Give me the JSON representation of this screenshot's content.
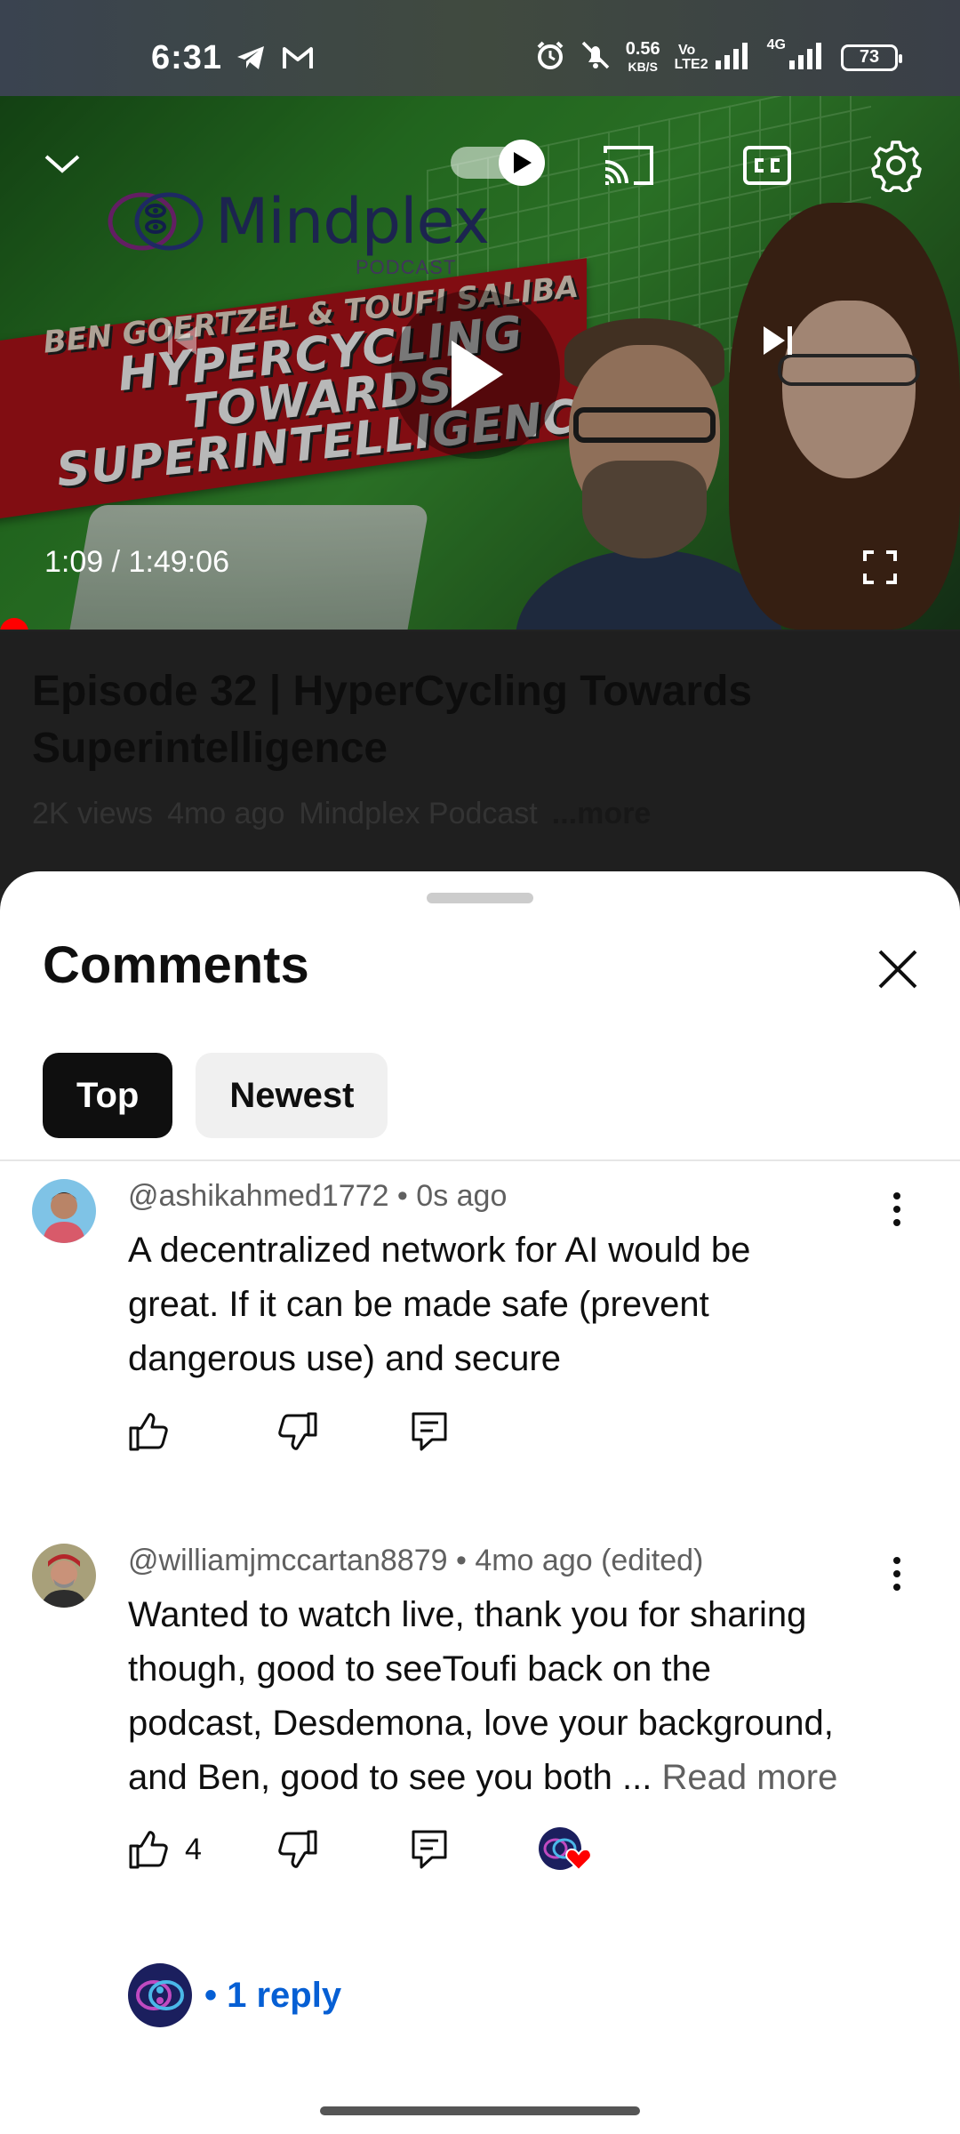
{
  "status_bar": {
    "time": "6:31",
    "net_speed": "0.56",
    "net_speed_unit": "KB/S",
    "volte": "Vo LTE2",
    "network": "4G",
    "battery": "73"
  },
  "player": {
    "thumbnail": {
      "logo_text": "Mindplex",
      "logo_sub": "PODCAST",
      "names": "BEN GOERTZEL & TOUFI SALIBA",
      "headline_lines": [
        "HYPERCYCLING",
        "TOWARDS",
        "SUPERINTELLIGENCE"
      ]
    },
    "current_time": "1:09",
    "separator": "/",
    "duration": "1:49:06",
    "progress_fraction": 0.01,
    "accent_color": "#ff0000"
  },
  "video": {
    "title": "Episode 32 | HyperCycling Towards Superintelligence",
    "views": "2K views",
    "age": "4mo ago",
    "channel": "Mindplex Podcast",
    "more_label": "...more"
  },
  "comments_panel": {
    "title": "Comments",
    "chips": [
      {
        "label": "Top",
        "active": true
      },
      {
        "label": "Newest",
        "active": false
      }
    ],
    "comments": [
      {
        "header": "@ashikahmed1772 • 0s ago",
        "lines": [
          "A decentralized network for AI would be",
          "great. If it can be made safe (prevent",
          "dangerous use) and secure"
        ],
        "likes": "",
        "has_creator_heart": false
      },
      {
        "header": "@williamjmccartan8879 • 4mo ago (edited)",
        "lines": [
          "Wanted to watch live, thank you for sharing",
          "though, good to seeToufi back on the",
          "podcast, Desdemona, love your background,",
          "and Ben,  good to see you both ..."
        ],
        "read_more": "Read more",
        "likes": "4",
        "has_creator_heart": true,
        "replies": "• 1 reply"
      }
    ]
  },
  "colors": {
    "link_blue": "#065fd4",
    "chip_active": "#0f0f0f",
    "chip_inactive": "#f0f0f0",
    "heart_red": "#ff0000"
  }
}
